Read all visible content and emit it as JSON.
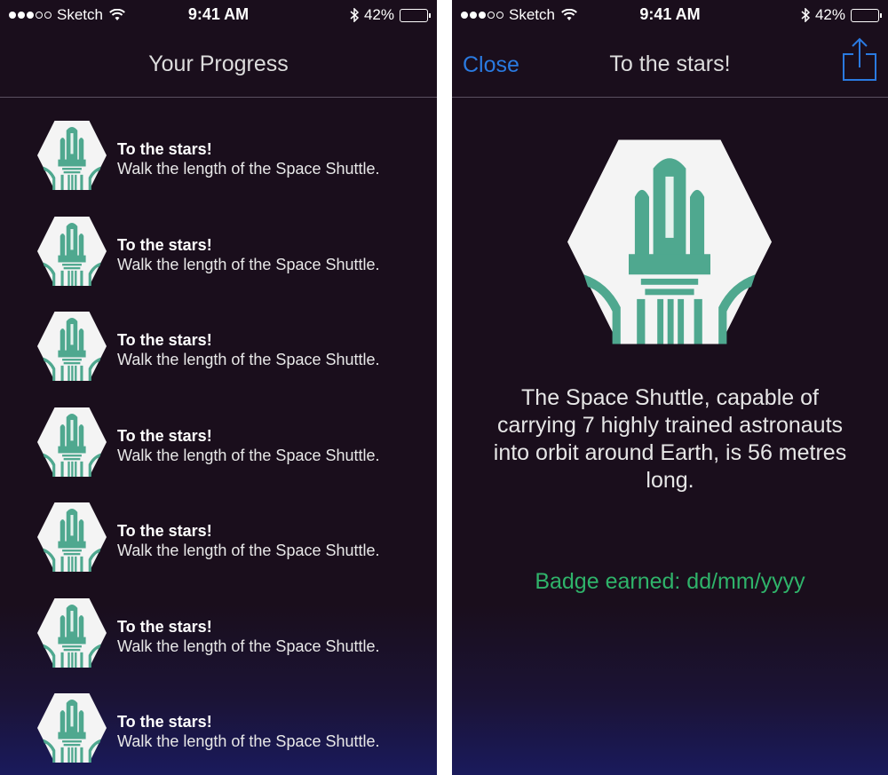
{
  "status": {
    "carrier": "Sketch",
    "time": "9:41 AM",
    "battery": "42%",
    "battery_level": 0.42
  },
  "left": {
    "title": "Your Progress",
    "items": [
      {
        "title": "To the stars!",
        "desc": "Walk the length of the Space Shuttle."
      },
      {
        "title": "To the stars!",
        "desc": "Walk the length of the Space Shuttle."
      },
      {
        "title": "To the stars!",
        "desc": "Walk the length of the Space Shuttle."
      },
      {
        "title": "To the stars!",
        "desc": "Walk the length of the Space Shuttle."
      },
      {
        "title": "To the stars!",
        "desc": "Walk the length of the Space Shuttle."
      },
      {
        "title": "To the stars!",
        "desc": "Walk the length of the Space Shuttle."
      },
      {
        "title": "To the stars!",
        "desc": "Walk the length of the Space Shuttle."
      }
    ]
  },
  "right": {
    "close_label": "Close",
    "title": "To the stars!",
    "description": "The Space Shuttle, capable of carrying 7 highly trained astronauts into orbit around Earth, is 56 metres long.",
    "earned": "Badge earned: dd/mm/yyyy"
  },
  "icons": {
    "badge": "space-shuttle-icon",
    "share": "share-icon"
  },
  "colors": {
    "accent_blue": "#2a7ae0",
    "badge_green": "#4fa88f",
    "earned_green": "#2fb36a",
    "background": "#1a0e1c"
  }
}
